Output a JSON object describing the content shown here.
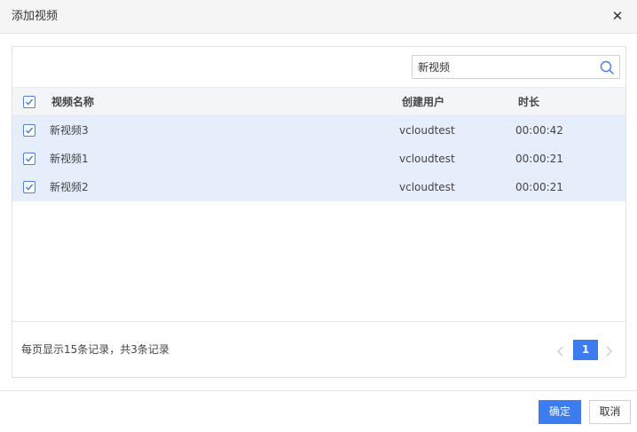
{
  "dialog": {
    "title": "添加视频",
    "close_icon": "close-icon"
  },
  "search": {
    "value": "新视频",
    "placeholder": ""
  },
  "table": {
    "select_all_checked": true,
    "columns": [
      "视频名称",
      "创建用户",
      "时长"
    ],
    "rows": [
      {
        "checked": true,
        "name": "新视频3",
        "user": "vcloudtest",
        "duration": "00:00:42"
      },
      {
        "checked": true,
        "name": "新视频1",
        "user": "vcloudtest",
        "duration": "00:00:21"
      },
      {
        "checked": true,
        "name": "新视频2",
        "user": "vcloudtest",
        "duration": "00:00:21"
      }
    ]
  },
  "pagination": {
    "summary": "每页显示15条记录，共3条记录",
    "current_page": "1"
  },
  "buttons": {
    "confirm": "确定",
    "cancel": "取消"
  },
  "colors": {
    "accent": "#3d7bf1",
    "row_selected": "#e7eefb",
    "header_bg": "#f5f5f6"
  }
}
